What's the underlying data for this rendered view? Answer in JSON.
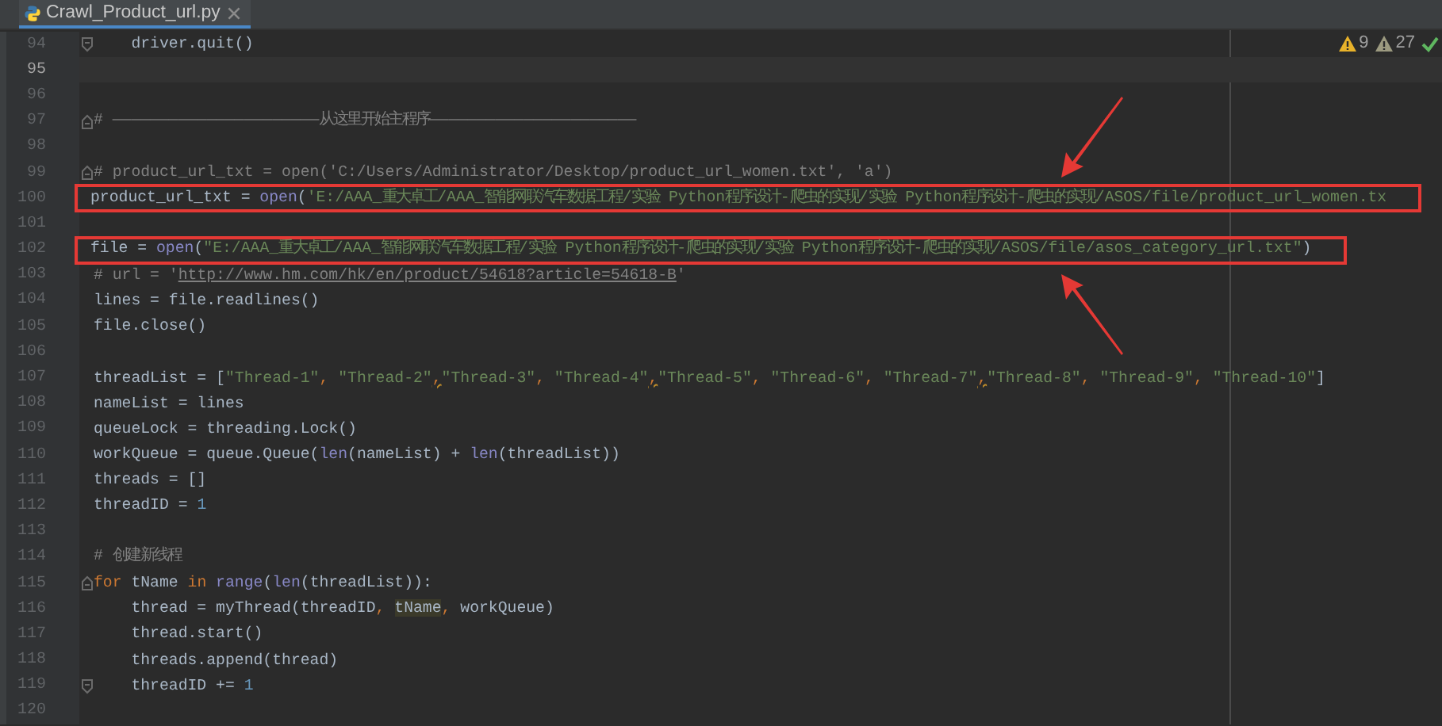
{
  "tabs": [
    {
      "label": "Crawl_Product_url.py",
      "selected": true
    }
  ],
  "inspections": [
    {
      "kind": "warning",
      "count": "9"
    },
    {
      "kind": "weak-warning",
      "count": "27"
    },
    {
      "kind": "ok"
    }
  ],
  "lines": [
    {
      "number": "94",
      "current": false,
      "fold_start": false,
      "fold_end": true,
      "tokens": [
        {
          "kind": "plain",
          "text": "    driver.quit()"
        }
      ]
    },
    {
      "number": "95",
      "current": true,
      "fold_start": false,
      "fold_end": false
    },
    {
      "number": "96",
      "current": false,
      "fold_start": false,
      "fold_end": false
    },
    {
      "number": "97",
      "current": false,
      "fold_start": true,
      "fold_end": false,
      "tokens": [
        {
          "kind": "comment",
          "text": "# ——————————————————————从这里开始主程序——————————————————————"
        }
      ]
    },
    {
      "number": "98",
      "current": false,
      "fold_start": false,
      "fold_end": false
    },
    {
      "number": "99",
      "current": false,
      "fold_start": true,
      "fold_end": false,
      "tokens": [
        {
          "kind": "comment",
          "text": "# product_url_txt = open('C:/Users/Administrator/Desktop/product_url_women.txt', 'a')"
        }
      ]
    },
    {
      "number": "100",
      "current": false,
      "fold_start": false,
      "fold_end": false,
      "marker": {
        "boxed": true,
        "arrow_from_above": true,
        "arrow_from_below": false
      },
      "tokens": [
        {
          "kind": "plain",
          "text": "product_url_txt = "
        },
        {
          "kind": "builtin",
          "text": "open"
        },
        {
          "kind": "plain",
          "text": "("
        },
        {
          "kind": "string",
          "text": "'E:/AAA_重大卓工/AAA_智能网联汽车数据工程/实验 Python程序设计-爬虫的实现/实验 Python程序设计-爬虫的实现/ASOS/file/product_url_women.tx"
        }
      ]
    },
    {
      "number": "101",
      "current": false,
      "fold_start": false,
      "fold_end": false
    },
    {
      "number": "102",
      "current": false,
      "fold_start": false,
      "fold_end": false,
      "marker": {
        "boxed": true,
        "arrow_from_above": false,
        "arrow_from_below": true
      },
      "tokens": [
        {
          "kind": "plain",
          "text": "file = "
        },
        {
          "kind": "builtin",
          "text": "open"
        },
        {
          "kind": "plain",
          "text": "("
        },
        {
          "kind": "string",
          "text": "\"E:/AAA_重大卓工/AAA_智能网联汽车数据工程/实验 Python程序设计-爬虫的实现/实验 Python程序设计-爬虫的实现/ASOS/file/asos_category_url.txt\""
        },
        {
          "kind": "plain",
          "text": ")"
        }
      ]
    },
    {
      "number": "103",
      "current": false,
      "fold_start": false,
      "fold_end": false,
      "tokens": [
        {
          "kind": "comment",
          "text": "# url = '"
        },
        {
          "kind": "link",
          "text": "http://www.hm.com/hk/en/product/54618?article=54618-B"
        },
        {
          "kind": "comment",
          "text": "'"
        }
      ]
    },
    {
      "number": "104",
      "current": false,
      "fold_start": false,
      "fold_end": false,
      "tokens": [
        {
          "kind": "plain",
          "text": "lines = file.readlines()"
        }
      ]
    },
    {
      "number": "105",
      "current": false,
      "fold_start": false,
      "fold_end": false,
      "tokens": [
        {
          "kind": "plain",
          "text": "file.close()"
        }
      ]
    },
    {
      "number": "106",
      "current": false,
      "fold_start": false,
      "fold_end": false
    },
    {
      "number": "107",
      "current": false,
      "fold_start": false,
      "fold_end": false,
      "tokens": [
        {
          "kind": "plain",
          "text": "threadList = ["
        },
        {
          "kind": "string",
          "text": "\"Thread-1\""
        },
        {
          "kind": "punct",
          "text": ", "
        },
        {
          "kind": "string",
          "text": "\"Thread-2\""
        },
        {
          "kind": "warn",
          "text": ","
        },
        {
          "kind": "string",
          "text": "\"Thread-3\""
        },
        {
          "kind": "punct",
          "text": ", "
        },
        {
          "kind": "string",
          "text": "\"Thread-4\""
        },
        {
          "kind": "warn",
          "text": ","
        },
        {
          "kind": "string",
          "text": "\"Thread-5\""
        },
        {
          "kind": "punct",
          "text": ", "
        },
        {
          "kind": "string",
          "text": "\"Thread-6\""
        },
        {
          "kind": "punct",
          "text": ", "
        },
        {
          "kind": "string",
          "text": "\"Thread-7\""
        },
        {
          "kind": "warn",
          "text": ","
        },
        {
          "kind": "string",
          "text": "\"Thread-8\""
        },
        {
          "kind": "punct",
          "text": ", "
        },
        {
          "kind": "string",
          "text": "\"Thread-9\""
        },
        {
          "kind": "punct",
          "text": ", "
        },
        {
          "kind": "string",
          "text": "\"Thread-10\""
        },
        {
          "kind": "plain",
          "text": "]"
        }
      ]
    },
    {
      "number": "108",
      "current": false,
      "fold_start": false,
      "fold_end": false,
      "tokens": [
        {
          "kind": "plain",
          "text": "nameList = lines"
        }
      ]
    },
    {
      "number": "109",
      "current": false,
      "fold_start": false,
      "fold_end": false,
      "tokens": [
        {
          "kind": "plain",
          "text": "queueLock = threading.Lock()"
        }
      ]
    },
    {
      "number": "110",
      "current": false,
      "fold_start": false,
      "fold_end": false,
      "tokens": [
        {
          "kind": "plain",
          "text": "workQueue = queue.Queue("
        },
        {
          "kind": "builtin",
          "text": "len"
        },
        {
          "kind": "plain",
          "text": "(nameList) + "
        },
        {
          "kind": "builtin",
          "text": "len"
        },
        {
          "kind": "plain",
          "text": "(threadList))"
        }
      ]
    },
    {
      "number": "111",
      "current": false,
      "fold_start": false,
      "fold_end": false,
      "tokens": [
        {
          "kind": "plain",
          "text": "threads = []"
        }
      ]
    },
    {
      "number": "112",
      "current": false,
      "fold_start": false,
      "fold_end": false,
      "tokens": [
        {
          "kind": "plain",
          "text": "threadID = "
        },
        {
          "kind": "number",
          "text": "1"
        }
      ]
    },
    {
      "number": "113",
      "current": false,
      "fold_start": false,
      "fold_end": false
    },
    {
      "number": "114",
      "current": false,
      "fold_start": false,
      "fold_end": false,
      "tokens": [
        {
          "kind": "comment",
          "text": "# 创建新线程"
        }
      ]
    },
    {
      "number": "115",
      "current": false,
      "fold_start": true,
      "fold_end": false,
      "tokens": [
        {
          "kind": "keyword",
          "text": "for"
        },
        {
          "kind": "plain",
          "text": " tName "
        },
        {
          "kind": "keyword",
          "text": "in"
        },
        {
          "kind": "builtin",
          "text": " range"
        },
        {
          "kind": "plain",
          "text": "("
        },
        {
          "kind": "builtin",
          "text": "len"
        },
        {
          "kind": "plain",
          "text": "(threadList)):"
        }
      ]
    },
    {
      "number": "116",
      "current": false,
      "fold_start": false,
      "fold_end": false,
      "tokens": [
        {
          "kind": "plain",
          "text": "    thread = myThread(threadID"
        },
        {
          "kind": "punct",
          "text": ", "
        },
        {
          "kind": "match",
          "text": "tName"
        },
        {
          "kind": "punct",
          "text": ", "
        },
        {
          "kind": "plain",
          "text": "workQueue)"
        }
      ]
    },
    {
      "number": "117",
      "current": false,
      "fold_start": false,
      "fold_end": false,
      "tokens": [
        {
          "kind": "plain",
          "text": "    thread.start()"
        }
      ]
    },
    {
      "number": "118",
      "current": false,
      "fold_start": false,
      "fold_end": false,
      "tokens": [
        {
          "kind": "plain",
          "text": "    threads.append(thread)"
        }
      ]
    },
    {
      "number": "119",
      "current": false,
      "fold_start": false,
      "fold_end": true,
      "tokens": [
        {
          "kind": "plain",
          "text": "    threadID += "
        },
        {
          "kind": "number",
          "text": "1"
        }
      ]
    },
    {
      "number": "120",
      "current": false,
      "fold_start": false,
      "fold_end": false
    }
  ]
}
